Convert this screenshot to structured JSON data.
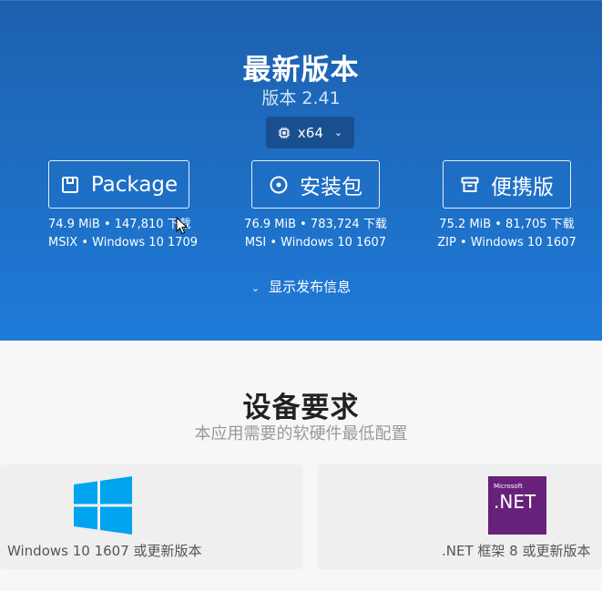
{
  "hero": {
    "title": "最新版本",
    "version": "版本 2.41",
    "arch": "x64",
    "release_toggle": "显示发布信息"
  },
  "downloads": [
    {
      "label": "Package",
      "icon": "package-icon",
      "meta1": "74.9 MiB • 147,810 下载",
      "meta2": "MSIX • Windows 10 1709"
    },
    {
      "label": "安装包",
      "icon": "disc-icon",
      "meta1": "76.9 MiB • 783,724 下载",
      "meta2": "MSI • Windows 10 1607"
    },
    {
      "label": "便携版",
      "icon": "archive-icon",
      "meta1": "75.2 MiB • 81,705 下载",
      "meta2": "ZIP • Windows 10 1607"
    }
  ],
  "requirements": {
    "title": "设备要求",
    "subtitle": "本应用需要的软硬件最低配置",
    "items": [
      {
        "label": "Windows 10 1607 或更新版本",
        "icon": "windows-logo-icon"
      },
      {
        "label": ".NET 框架 8 或更新版本",
        "icon": "dotnet-logo-icon",
        "logo_top": "Microsoft",
        "logo_main": ".NET"
      }
    ]
  },
  "colors": {
    "hero_top": "#1d60ae",
    "hero_bottom": "#1f7ad8",
    "windows_blue": "#00a4ef",
    "dotnet_purple": "#68217a"
  }
}
